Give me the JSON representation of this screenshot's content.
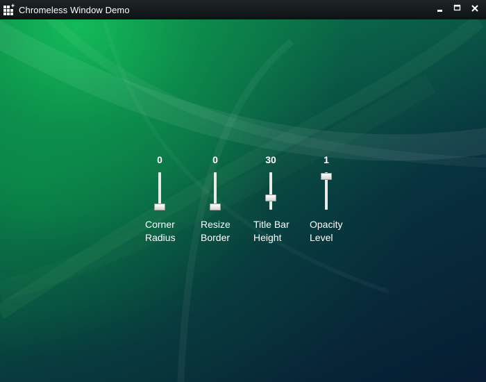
{
  "window": {
    "title": "Chromeless Window Demo",
    "app_icon": "app-grid-icon",
    "controls": {
      "minimize_icon": "minimize-icon",
      "maximize_icon": "maximize-icon",
      "close_icon": "close-icon"
    }
  },
  "colors": {
    "titlebar": "#14191b",
    "bg_green": "#0c8c49",
    "bg_navy": "#071d33",
    "text": "#ffffff",
    "track": "#eaeaea"
  },
  "sliders": [
    {
      "value": "0",
      "label": "Corner\nRadius",
      "level": 0
    },
    {
      "value": "0",
      "label": "Resize\nBorder",
      "level": 0
    },
    {
      "value": "30",
      "label": "Title Bar\nHeight",
      "level": 0.3
    },
    {
      "value": "1",
      "label": "Opacity\nLevel",
      "level": 1
    }
  ]
}
